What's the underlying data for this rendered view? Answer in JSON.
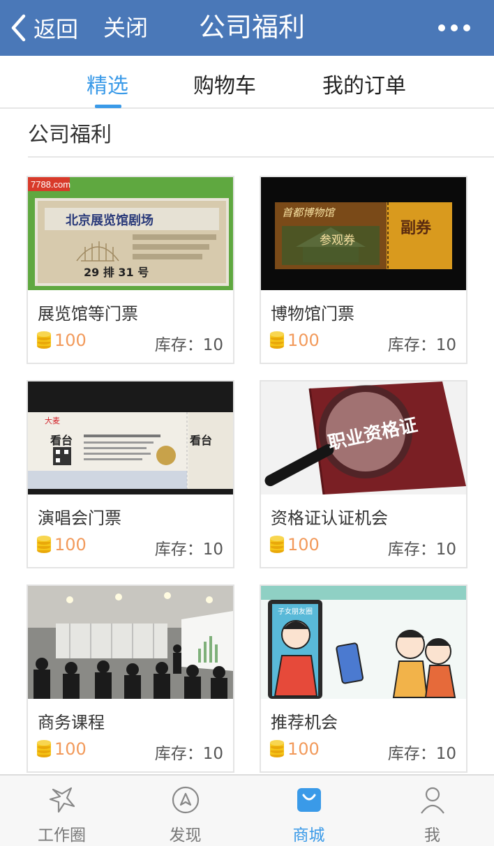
{
  "header": {
    "back_label": "返回",
    "close_label": "关闭",
    "title": "公司福利",
    "back_icon": "chevron-left-icon",
    "more_icon": "more-dots-icon"
  },
  "tabs": [
    {
      "label": "精选",
      "active": true
    },
    {
      "label": "购物车",
      "active": false
    },
    {
      "label": "我的订单",
      "active": false
    }
  ],
  "section": {
    "title": "公司福利"
  },
  "products": [
    {
      "name": "展览馆等门票",
      "price": "100",
      "stock": "库存：10",
      "image": "exhibition-ticket"
    },
    {
      "name": "博物馆门票",
      "price": "100",
      "stock": "库存：10",
      "image": "museum-ticket"
    },
    {
      "name": "演唱会门票",
      "price": "100",
      "stock": "库存：10",
      "image": "concert-ticket"
    },
    {
      "name": "资格证认证机会",
      "price": "100",
      "stock": "库存：10",
      "image": "certificate"
    },
    {
      "name": "商务课程",
      "price": "100",
      "stock": "库存：10",
      "image": "business-course"
    },
    {
      "name": "推荐机会",
      "price": "100",
      "stock": "库存：10",
      "image": "referral"
    }
  ],
  "tabbar": [
    {
      "label": "工作圈",
      "icon": "work-circle-icon",
      "active": false
    },
    {
      "label": "发现",
      "icon": "discover-compass-icon",
      "active": false
    },
    {
      "label": "商城",
      "icon": "shopping-bag-icon",
      "active": true
    },
    {
      "label": "我",
      "icon": "person-icon",
      "active": false
    }
  ],
  "colors": {
    "header_bg": "#4a78b8",
    "accent": "#3a9ae8",
    "price": "#f29a5b",
    "coin": "#f5c518"
  },
  "image_text": {
    "exhibition_site": "7788.com",
    "exhibition_venue": "北京展览馆剧场",
    "exhibition_seat": "29 排 31 号",
    "museum_name": "首都博物馆",
    "museum_visit": "参观券",
    "museum_stub": "副券",
    "concert_brand": "大麦",
    "concert_seat": "看台",
    "cert_text": "职业资格证",
    "referral_phone": "子女朋友圈"
  }
}
